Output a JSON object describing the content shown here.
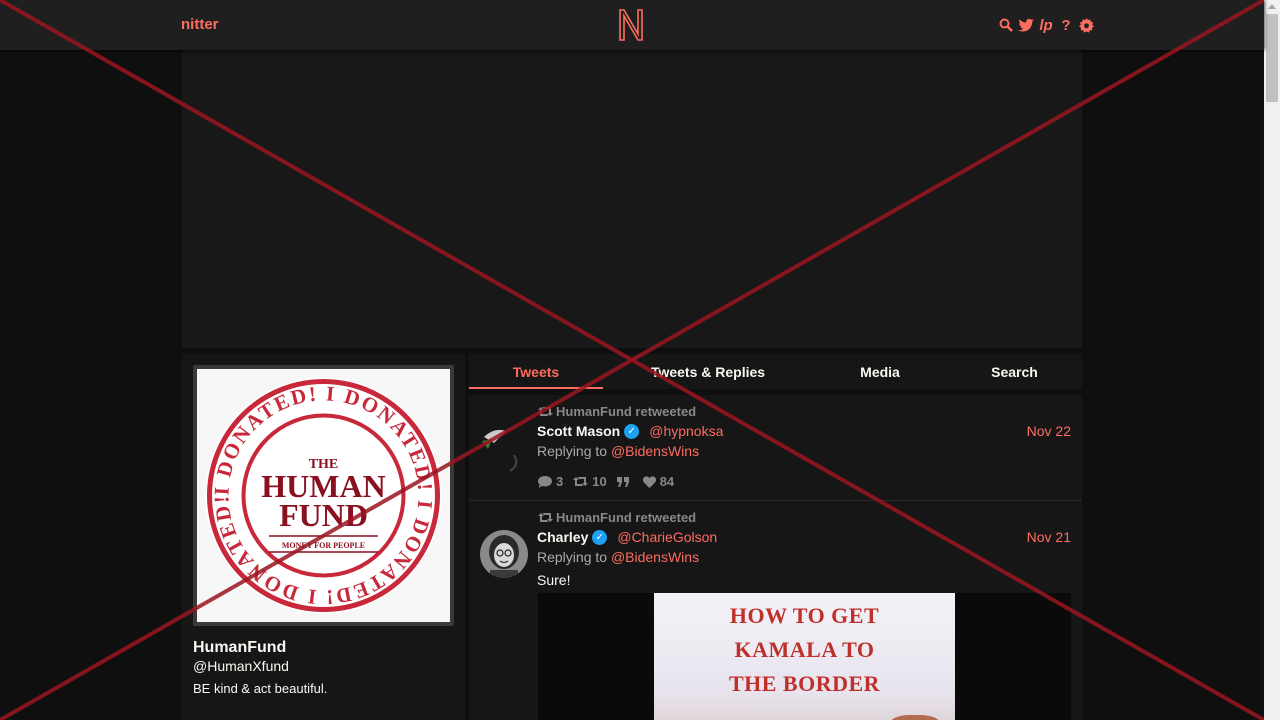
{
  "nav": {
    "brand": "nitter",
    "logo_letter": "N",
    "icons": [
      "search-icon",
      "twitter-bird-icon",
      "rss-icon",
      "help-icon",
      "settings-gear-icon"
    ],
    "rss_glyph": "lp",
    "help_glyph": "?"
  },
  "profile": {
    "name": "HumanFund",
    "handle": "@HumanXfund",
    "bio": "BE kind & act beautiful.",
    "avatar": {
      "ring_text": "I DONATED! I DONATED! I DONATED! I DONATED!",
      "line1": "THE",
      "line2": "HUMAN",
      "line3": "FUND",
      "tagline": "MONEY FOR PEOPLE"
    }
  },
  "tabs": [
    {
      "label": "Tweets",
      "active": true
    },
    {
      "label": "Tweets & Replies",
      "active": false
    },
    {
      "label": "Media",
      "active": false
    },
    {
      "label": "Search",
      "active": false
    }
  ],
  "tweets": [
    {
      "retweet_label": "HumanFund retweeted",
      "name": "Scott Mason",
      "handle": "@hypnoksa",
      "date": "Nov 22",
      "replying_prefix": "Replying to",
      "replying_to": "@BidensWins",
      "stats": {
        "comments": "3",
        "retweets": "10",
        "quotes": "",
        "likes": "84"
      }
    },
    {
      "retweet_label": "HumanFund retweeted",
      "name": "Charley",
      "handle": "@CharieGolson",
      "date": "Nov 21",
      "replying_prefix": "Replying to",
      "replying_to": "@BidensWins",
      "text": "Sure!",
      "media_lines": [
        "HOW TO GET",
        "KAMALA TO",
        "THE BORDER"
      ]
    }
  ],
  "colors": {
    "accent": "#ff6c60",
    "background": "#0f0f0f",
    "panel": "#161616",
    "navbar": "#1f1f1f",
    "verified": "#1da1f2",
    "muted": "#888889"
  }
}
